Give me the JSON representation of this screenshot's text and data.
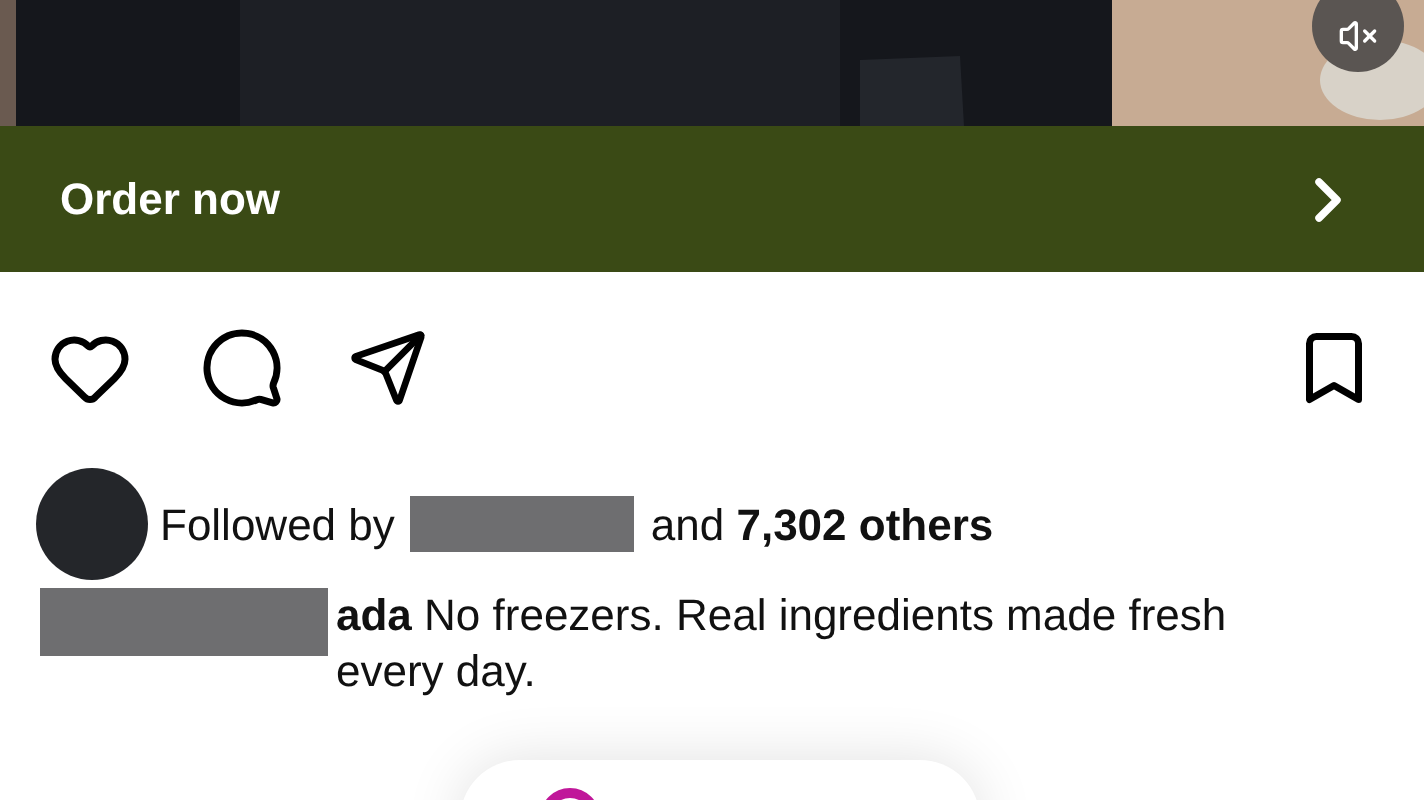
{
  "post_media": {
    "muted": true
  },
  "cta_bar": {
    "label": "Order now"
  },
  "actions": {
    "liked": false,
    "saved": false
  },
  "followed_by": {
    "text": "Followed by",
    "rest": "and **7,302 others**"
  },
  "caption": {
    "text": "**ada** No freezers. Real ingredients made fresh every day."
  }
}
